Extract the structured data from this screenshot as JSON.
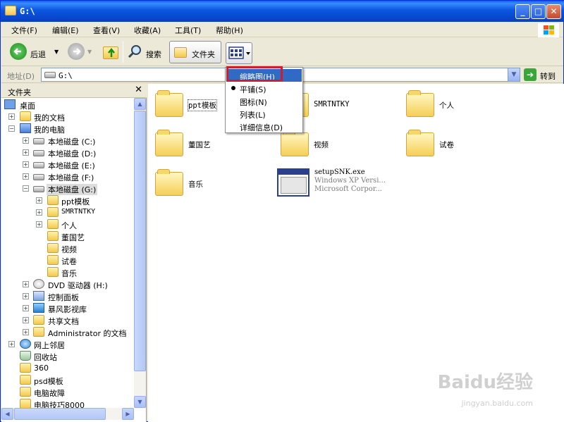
{
  "window": {
    "title": "G:\\"
  },
  "menubar": [
    "文件(F)",
    "编辑(E)",
    "查看(V)",
    "收藏(A)",
    "工具(T)",
    "帮助(H)"
  ],
  "toolbar": {
    "back": "后退",
    "search": "搜索",
    "folders": "文件夹"
  },
  "address": {
    "label": "地址(D)",
    "value": "G:\\",
    "go": "转到"
  },
  "leftpane": {
    "title": "文件夹",
    "tree": [
      "桌面",
      "我的文档",
      "我的电脑",
      "本地磁盘 (C:)",
      "本地磁盘 (D:)",
      "本地磁盘 (E:)",
      "本地磁盘 (F:)",
      "本地磁盘 (G:)",
      "ppt模板",
      "SMRTNTKY",
      "个人",
      "董国艺",
      "视频",
      "试卷",
      "音乐",
      "DVD 驱动器 (H:)",
      "控制面板",
      "暴风影视库",
      "共享文档",
      "Administrator 的文档",
      "网上邻居",
      "回收站",
      "360",
      "psd模板",
      "电脑故障",
      "电脑技巧8000"
    ]
  },
  "items": [
    {
      "name": "ppt模板"
    },
    {
      "name": "SMRTNTKY"
    },
    {
      "name": "个人"
    },
    {
      "name": "董国艺"
    },
    {
      "name": "视频"
    },
    {
      "name": "试卷"
    },
    {
      "name": "音乐"
    }
  ],
  "exe": {
    "name": "setupSNK.exe",
    "desc1": "Windows XP Versi...",
    "desc2": "Microsoft Corpor..."
  },
  "viewmenu": [
    "缩略图(H)",
    "平铺(S)",
    "图标(N)",
    "列表(L)",
    "详细信息(D)"
  ],
  "watermark": {
    "brand": "Baidu经验",
    "url": "jingyan.baidu.com"
  },
  "colors": {
    "titlebar": "#0b55e0",
    "highlight": "#316ac5",
    "callout": "#d41b2c"
  }
}
